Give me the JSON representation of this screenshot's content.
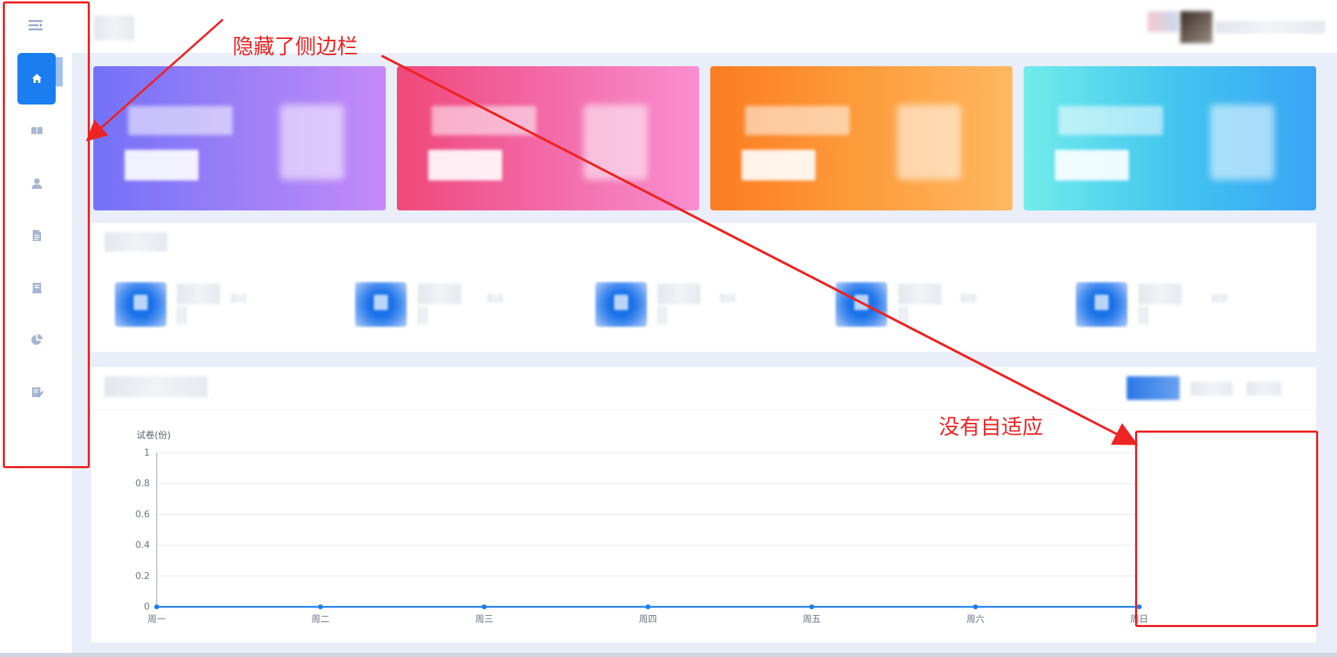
{
  "sidebar": {
    "items": [
      {
        "icon": "home-icon",
        "active": true
      },
      {
        "icon": "book-icon",
        "active": false
      },
      {
        "icon": "user-icon",
        "active": false
      },
      {
        "icon": "document-icon",
        "active": false
      },
      {
        "icon": "list-icon",
        "active": false
      },
      {
        "icon": "pie-chart-icon",
        "active": false
      },
      {
        "icon": "edit-icon",
        "active": false
      }
    ],
    "toggle_icon": "menu-fold-icon"
  },
  "annotations": {
    "sidebar_note": "隐藏了侧边栏",
    "chart_note": "没有自适应"
  },
  "chart_data": {
    "type": "line",
    "categories": [
      "周一",
      "周二",
      "周三",
      "周四",
      "周五",
      "周六",
      "周日"
    ],
    "series": [
      {
        "values": [
          0,
          0,
          0,
          0,
          0,
          0,
          0
        ]
      }
    ],
    "ylabel": "试卷(份)",
    "ylim": [
      0,
      1
    ],
    "yticks": [
      "0",
      "0.2",
      "0.4",
      "0.6",
      "0.8",
      "1"
    ],
    "grid": true,
    "color": "#1a7ef0"
  },
  "colors": {
    "accent": "#1a7ef0",
    "annotation": "#ee2323",
    "card_purple": "#8b78f7",
    "card_pink": "#f2609b",
    "card_orange": "#fd9c3c",
    "card_cyan": "#43c6ef"
  }
}
